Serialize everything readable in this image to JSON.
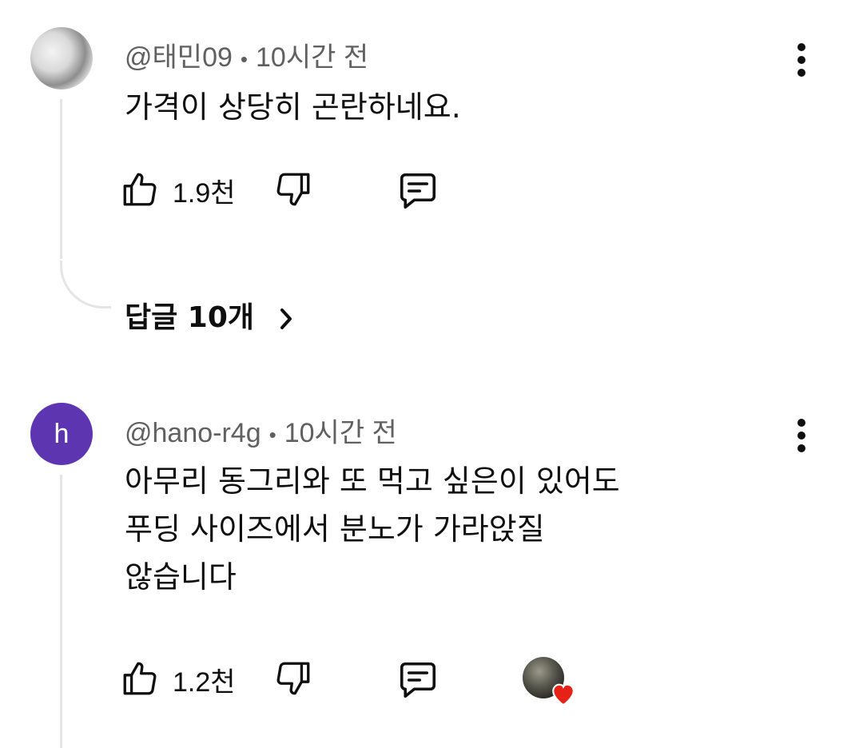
{
  "comments": [
    {
      "author": "@태민09",
      "time": "10시간 전",
      "separator": "•",
      "text": "가격이 상당히 곤란하네요.",
      "likes": "1.9천",
      "replies_label": "답글 10개",
      "avatar": "photo"
    },
    {
      "author": "@hano-r4g",
      "time": "10시간 전",
      "separator": "•",
      "avatar_letter": "h",
      "avatar_color": "#5e35b1",
      "text_lines": [
        "아무리 동그리와 또 먹고 싶은이 있어도",
        "푸딩 사이즈에서 분노가 가라앉질",
        "않습니다"
      ],
      "likes": "1.2천",
      "creator_heart": true,
      "heart_color": "#e62117"
    }
  ],
  "icons": {
    "like": "thumbs-up-icon",
    "dislike": "thumbs-down-icon",
    "reply": "reply-comment-icon",
    "more": "more-vertical-icon",
    "chevron": "chevron-right-icon"
  }
}
